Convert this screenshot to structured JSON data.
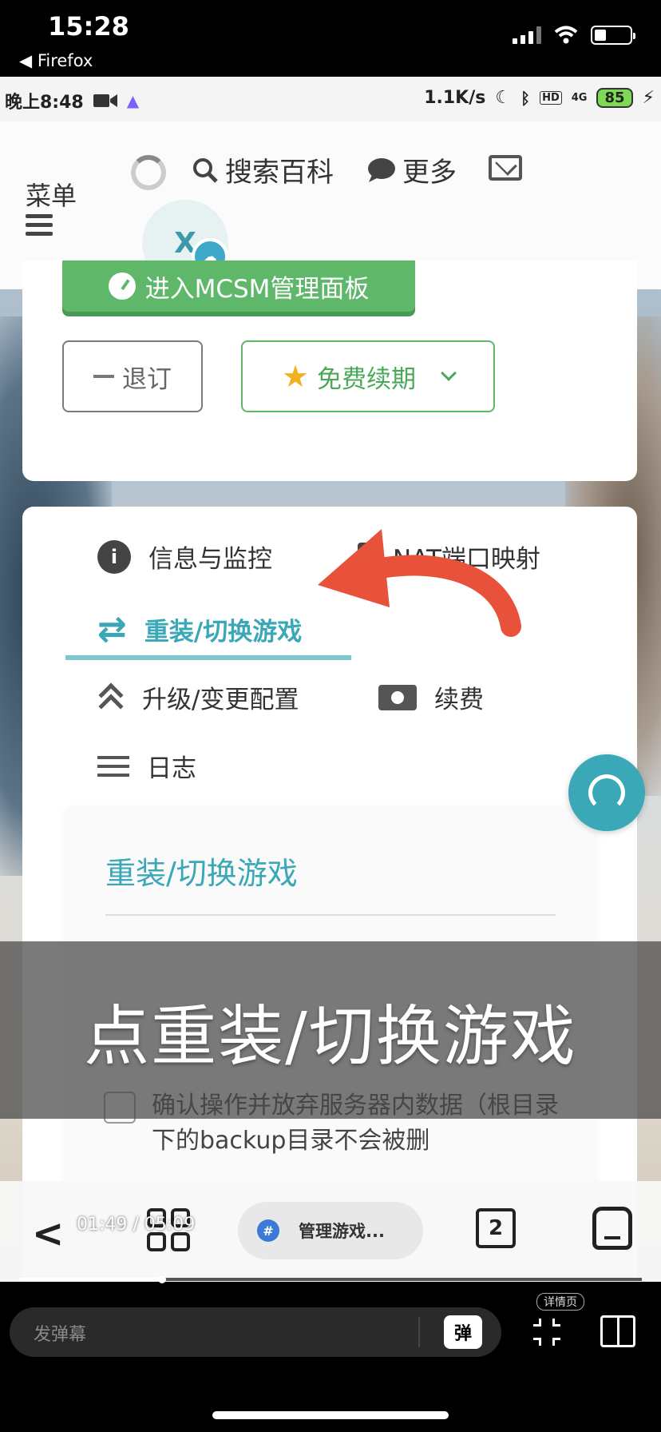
{
  "ios": {
    "time": "15:28",
    "back_app": "◀ Firefox"
  },
  "android_status": {
    "time": "晚上8:48",
    "speed": "1.1K/s",
    "network": "4G",
    "battery": "85",
    "hd": "HD"
  },
  "header": {
    "menu_label": "菜单",
    "search_label": "搜索百科",
    "more_label": "更多",
    "avatar_initial": "X"
  },
  "panel_actions": {
    "mcsm_button": "进入MCSM管理面板",
    "unsubscribe_button": "退订",
    "renew_button": "免费续期"
  },
  "tabs": {
    "info": "信息与监控",
    "nat": "NAT端口映射",
    "reinstall": "重装/切换游戏",
    "upgrade": "升级/变更配置",
    "renewal": "续费",
    "log": "日志"
  },
  "section": {
    "title": "重装/切换游戏",
    "confirm_text": "确认操作并放弃服务器内数据（根目录下的backup目录不会被删"
  },
  "subtitle": "点重装/切换游戏",
  "phone_nav": {
    "tab_title": "管理游戏...",
    "tab_count": "2"
  },
  "player": {
    "timecode": "01:49 / 05:09",
    "progress": 0.23,
    "danmaku_placeholder": "发弹幕",
    "danmaku_toggle": "弹",
    "detail_tag": "详情页"
  },
  "colors": {
    "accent_teal": "#3aa8b6",
    "green": "#5fb86a",
    "annotation_arrow": "#e8523a"
  }
}
